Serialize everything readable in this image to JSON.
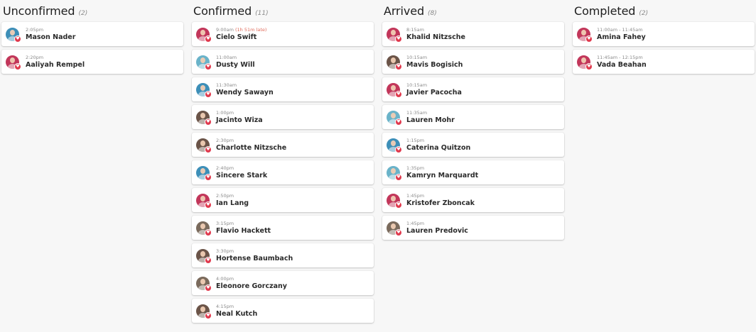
{
  "columns": [
    {
      "title": "Unconfirmed",
      "count": "(2)",
      "cards": [
        {
          "time": "2:05pm",
          "name": "Mason Nader",
          "avatar_color": "#3d8fb8"
        },
        {
          "time": "2:20pm",
          "name": "Aaliyah Rempel",
          "avatar_color": "#c2365a"
        }
      ]
    },
    {
      "title": "Confirmed",
      "count": "(11)",
      "cards": [
        {
          "time": "9:00am",
          "late": "(1h 51m late)",
          "name": "Cielo Swift",
          "avatar_color": "#c2365a"
        },
        {
          "time": "11:00am",
          "name": "Dusty Will",
          "avatar_color": "#6ab3c9"
        },
        {
          "time": "11:30am",
          "name": "Wendy Sawayn",
          "avatar_color": "#3d8fb8"
        },
        {
          "time": "1:00pm",
          "name": "Jacinto Wiza",
          "avatar_color": "#6b5448"
        },
        {
          "time": "2:30pm",
          "name": "Charlotte Nitzsche",
          "avatar_color": "#6b5448"
        },
        {
          "time": "2:40pm",
          "name": "Sincere Stark",
          "avatar_color": "#3d8fb8"
        },
        {
          "time": "2:50pm",
          "name": "Ian Lang",
          "avatar_color": "#c2365a"
        },
        {
          "time": "3:15pm",
          "name": "Flavio Hackett",
          "avatar_color": "#7a6a5c"
        },
        {
          "time": "3:30pm",
          "name": "Hortense Baumbach",
          "avatar_color": "#6b5448"
        },
        {
          "time": "4:00pm",
          "name": "Eleonore Gorczany",
          "avatar_color": "#7a6a5c"
        },
        {
          "time": "4:15pm",
          "name": "Neal Kutch",
          "avatar_color": "#6b5448"
        }
      ]
    },
    {
      "title": "Arrived",
      "count": "(8)",
      "cards": [
        {
          "time": "8:15am",
          "name": "Khalid Nitzsche",
          "avatar_color": "#c2365a"
        },
        {
          "time": "10:15am",
          "name": "Mavis Bogisich",
          "avatar_color": "#6b5448"
        },
        {
          "time": "10:15am",
          "name": "Javier Pacocha",
          "avatar_color": "#c2365a"
        },
        {
          "time": "11:35am",
          "name": "Lauren Mohr",
          "avatar_color": "#6ab3c9"
        },
        {
          "time": "1:15pm",
          "name": "Caterina Quitzon",
          "avatar_color": "#3d8fb8"
        },
        {
          "time": "1:35pm",
          "name": "Kamryn Marquardt",
          "avatar_color": "#6ab3c9"
        },
        {
          "time": "1:45pm",
          "name": "Kristofer Zboncak",
          "avatar_color": "#c2365a"
        },
        {
          "time": "1:45pm",
          "name": "Lauren Predovic",
          "avatar_color": "#7a6a5c"
        }
      ]
    },
    {
      "title": "Completed",
      "count": "(2)",
      "cards": [
        {
          "time": "11:00am - 11:45am",
          "name": "Amina Fahey",
          "avatar_color": "#c2365a"
        },
        {
          "time": "11:45am - 12:15pm",
          "name": "Vada Beahan",
          "avatar_color": "#c2365a"
        }
      ]
    }
  ],
  "heart_icon": "heart-icon"
}
